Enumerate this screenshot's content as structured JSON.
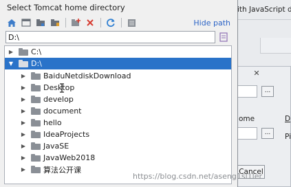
{
  "background_window": {
    "title_fragment": "ith JavaScript d",
    "field_label_fragment": "ome",
    "side_letter_1": "D",
    "side_letter_2": "Pi",
    "close_glyph": "✕",
    "browse_label": "...",
    "cancel_label": "Cancel"
  },
  "dialog": {
    "title": "Select Tomcat home directory",
    "hide_path_label": "Hide path",
    "path_value": "D:\\",
    "toolbar_icons": [
      "home-icon",
      "desktop-icon",
      "project-icon",
      "module-icon",
      "new-folder-icon",
      "delete-icon",
      "refresh-icon",
      "show-hidden-icon"
    ]
  },
  "tree": {
    "items": [
      {
        "label": "C:\\",
        "expanded": false,
        "selected": false
      },
      {
        "label": "D:\\",
        "expanded": true,
        "selected": true
      },
      {
        "label": "BaiduNetdiskDownload",
        "expanded": false,
        "selected": false
      },
      {
        "label": "Desktop",
        "expanded": false,
        "selected": false
      },
      {
        "label": "develop",
        "expanded": false,
        "selected": false
      },
      {
        "label": "document",
        "expanded": false,
        "selected": false
      },
      {
        "label": "hello",
        "expanded": false,
        "selected": false
      },
      {
        "label": "IdeaProjects",
        "expanded": false,
        "selected": false
      },
      {
        "label": "JavaSE",
        "expanded": false,
        "selected": false
      },
      {
        "label": "JavaWeb2018",
        "expanded": false,
        "selected": false
      },
      {
        "label": "算法公开课",
        "expanded": false,
        "selected": false
      }
    ]
  },
  "watermark": "https://blog.csdn.net/aseng1sl1ler",
  "colors": {
    "selection": "#2a73c9",
    "link": "#2b63c6",
    "delete": "#d63a2f",
    "refresh": "#2f7fd2"
  }
}
